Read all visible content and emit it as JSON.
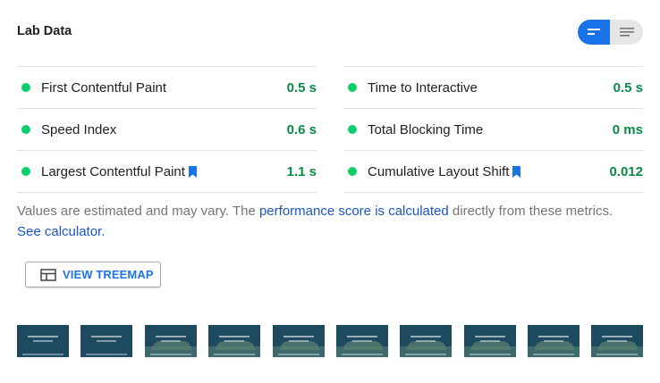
{
  "section": {
    "title": "Lab Data"
  },
  "toggle": {
    "left_icon": "summary-view-icon",
    "right_icon": "list-view-icon",
    "active": "left",
    "active_color": "#1a73e8"
  },
  "metrics": {
    "left": [
      {
        "name": "First Contentful Paint",
        "value": "0.5 s",
        "status": "pass",
        "bookmark": false
      },
      {
        "name": "Speed Index",
        "value": "0.6 s",
        "status": "pass",
        "bookmark": false
      },
      {
        "name": "Largest Contentful Paint",
        "value": "1.1 s",
        "status": "pass",
        "bookmark": true
      }
    ],
    "right": [
      {
        "name": "Time to Interactive",
        "value": "0.5 s",
        "status": "pass",
        "bookmark": false
      },
      {
        "name": "Total Blocking Time",
        "value": "0 ms",
        "status": "pass",
        "bookmark": false
      },
      {
        "name": "Cumulative Layout Shift",
        "value": "0.012",
        "status": "pass",
        "bookmark": true
      }
    ],
    "pass_color": "#0cce6b",
    "value_color": "#0a8a44"
  },
  "note": {
    "text_before": "Values are estimated and may vary. The ",
    "link1": "performance score is calculated",
    "text_middle": " directly from these metrics. ",
    "link2": "See calculator."
  },
  "treemap_button": {
    "label": "VIEW TREEMAP",
    "icon": "treemap-icon"
  },
  "filmstrip": {
    "frame_count": 10
  }
}
